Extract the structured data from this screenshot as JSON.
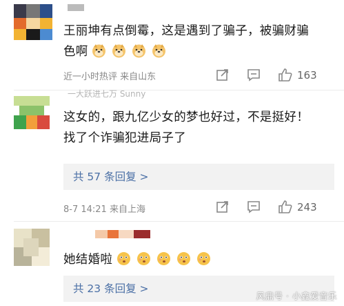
{
  "comments": [
    {
      "username": "",
      "text_line1": "王丽坤有点倒霉，这是遇到了骗子，被骗财骗",
      "text_line2": "色啊",
      "emoji_name": "doge-emoji",
      "emoji_count": 4,
      "meta": "近一小时热评   来自山东",
      "likes": "163",
      "colors": [
        "#3a3a4a",
        "#f2b333",
        "#e36b2c",
        "#2d4f8a",
        "#f6d7a0",
        "#1a1a1a"
      ]
    },
    {
      "username": "一大跃进七万 Sunny",
      "text_line1": "这女的，跟九亿少女的梦也好过，不是挺好！",
      "text_line2": "找了个诈骗犯进局子了",
      "replies": "共 57 条回复  >",
      "meta": "8-7 14:21   来自上海",
      "likes": "243",
      "colors": [
        "#b9d67a",
        "#3fa34d",
        "#d94b3e",
        "#f29f3b",
        "#8cc26a",
        "#2b7a3b"
      ]
    },
    {
      "username": "",
      "text_line1": "她结婚啦",
      "emoji_name": "thinking-emoji",
      "emoji_count": 5,
      "replies": "共 23 条回复  >",
      "colors": [
        "#e8e2c8",
        "#c9c0a0",
        "#f3ecd8",
        "#b8b39a",
        "#ddd6bc",
        "#a89f84"
      ]
    }
  ],
  "watermark": "风鼎号 · 小鑫爱音乐"
}
